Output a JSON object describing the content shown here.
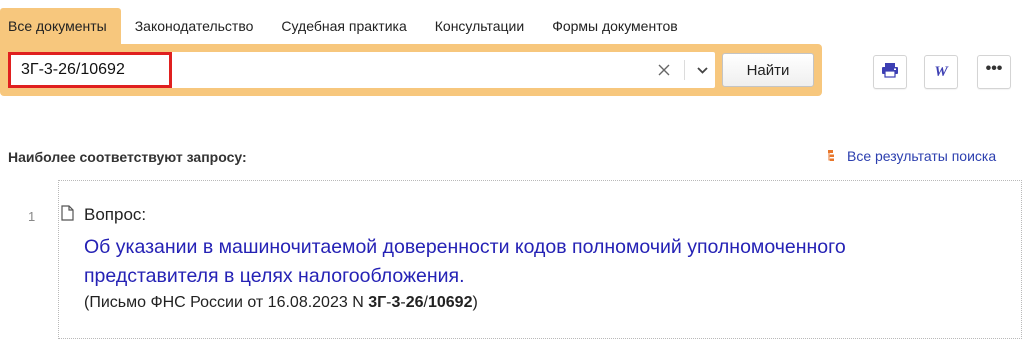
{
  "tabs": [
    {
      "label": "Все документы"
    },
    {
      "label": "Законодательство"
    },
    {
      "label": "Судебная практика"
    },
    {
      "label": "Консультации"
    },
    {
      "label": "Формы документов"
    }
  ],
  "search": {
    "query": "3Г-3-26/10692",
    "button_label": "Найти"
  },
  "toolbar": {
    "word_label": "W",
    "more_label": "•••"
  },
  "results": {
    "section_title": "Наиболее соответствуют запросу:",
    "all_results_label": "Все результаты поиска",
    "items": [
      {
        "number": "1",
        "label": "Вопрос:",
        "title": "Об указании в машиночитаемой доверенности кодов полномочий уполномоченного представителя в целях налогообложения.",
        "meta_prefix": "(Письмо ФНС России от 16.08.2023 N ",
        "meta_parts": [
          "3Г",
          "-",
          "3",
          "-",
          "26",
          "/",
          "10692"
        ],
        "meta_suffix": ")"
      }
    ]
  },
  "colors": {
    "accent": "#f7c77d",
    "highlight_border": "#e0201f",
    "link": "#2522b5"
  }
}
